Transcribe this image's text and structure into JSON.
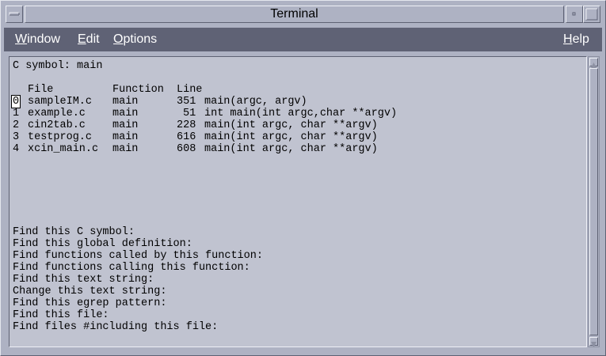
{
  "window": {
    "title": "Terminal",
    "minimize_glyph": "▫",
    "maximize_glyph": "□"
  },
  "menubar": {
    "items": [
      {
        "mnemonic": "W",
        "rest": "indow"
      },
      {
        "mnemonic": "E",
        "rest": "dit"
      },
      {
        "mnemonic": "O",
        "rest": "ptions"
      }
    ],
    "help": {
      "mnemonic": "H",
      "rest": "elp"
    }
  },
  "terminal": {
    "symbol_line": "C symbol: main",
    "headers": {
      "file": "File",
      "function": "Function",
      "line": "Line"
    },
    "results": [
      {
        "index": "0",
        "file": "sampleIM.c",
        "function": "main",
        "line": "351",
        "text": "main(argc, argv)"
      },
      {
        "index": "1",
        "file": "example.c",
        "function": "main",
        "line": "51",
        "text": "int main(int argc,char **argv)"
      },
      {
        "index": "2",
        "file": "cin2tab.c",
        "function": "main",
        "line": "228",
        "text": "main(int argc, char **argv)"
      },
      {
        "index": "3",
        "file": "testprog.c",
        "function": "main",
        "line": "616",
        "text": "main(int argc, char **argv)"
      },
      {
        "index": "4",
        "file": "xcin_main.c",
        "function": "main",
        "line": "608",
        "text": "main(int argc, char **argv)"
      }
    ],
    "prompts": [
      "Find this C symbol:",
      "Find this global definition:",
      "Find functions called by this function:",
      "Find functions calling this function:",
      "Find this text string:",
      "Change this text string:",
      "Find this egrep pattern:",
      "Find this file:",
      "Find files #including this file:"
    ]
  },
  "colors": {
    "menubar_bg": "#5f6275",
    "terminal_bg": "#c0c3d0",
    "chrome_bg": "#aeb2c3"
  }
}
